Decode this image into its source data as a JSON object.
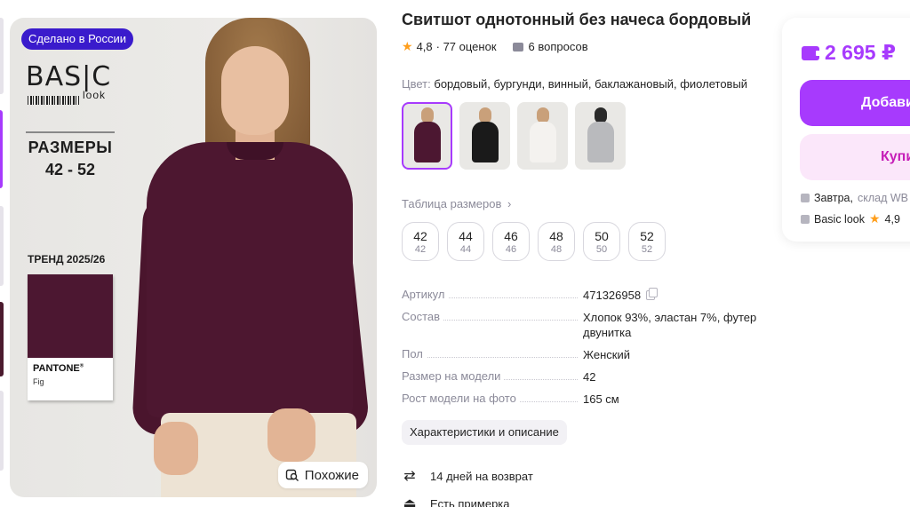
{
  "badges": {
    "made_in": "Сделано в России"
  },
  "brand_image": {
    "logo_top": "BAS|C",
    "logo_bottom": "look",
    "sizes_title": "РАЗМЕРЫ",
    "sizes_range": "42 - 52",
    "trend": "ТРЕНД 2025/26",
    "pantone_brand": "PANTONE",
    "pantone_color": "Fig"
  },
  "similar_button": "Похожие",
  "product": {
    "title": "Свитшот однотонный без начеса бордовый",
    "rating": "4,8",
    "reviews": "· 77 оценок",
    "questions": "6 вопросов",
    "color_label": "Цвет:",
    "color_value": "бордовый, бургунди, винный, баклажановый, фиолетовый"
  },
  "variants": [
    {
      "color": "#4c1731",
      "selected": true
    },
    {
      "color": "#1a1a1a",
      "selected": false
    },
    {
      "color": "#f4f2ef",
      "selected": false
    },
    {
      "color": "#b9babd",
      "selected": false
    }
  ],
  "size_table_link": "Таблица размеров",
  "sizes": [
    {
      "ru": "42",
      "int": "42"
    },
    {
      "ru": "44",
      "int": "44"
    },
    {
      "ru": "46",
      "int": "46"
    },
    {
      "ru": "48",
      "int": "48"
    },
    {
      "ru": "50",
      "int": "50"
    },
    {
      "ru": "52",
      "int": "52"
    }
  ],
  "specs": [
    {
      "key": "Артикул",
      "value": "471326958",
      "copy": true
    },
    {
      "key": "Состав",
      "value": "Хлопок 93%, эластан 7%, футер двунитка"
    },
    {
      "key": "Пол",
      "value": "Женский"
    },
    {
      "key": "Размер на модели",
      "value": "42"
    },
    {
      "key": "Рост модели на фото",
      "value": "165 см"
    }
  ],
  "chars_button": "Характеристики и описание",
  "features": [
    {
      "icon": "return-icon",
      "text": "14 дней на возврат"
    },
    {
      "icon": "hanger-icon",
      "text": "Есть примерка"
    }
  ],
  "price_panel": {
    "price": "2 695 ₽",
    "add_button": "Добавить в корзину",
    "buy_button": "Купить сейчас",
    "delivery_day": "Завтра,",
    "delivery_warehouse": "склад WB",
    "seller": "Basic look",
    "seller_rating": "4,9"
  },
  "colors": {
    "accent": "#a73afd",
    "badge_blue": "#3a1bcc",
    "star": "#ff9e1b",
    "muted": "#8b8a99",
    "buy_bg": "#fbe7fa",
    "buy_text": "#c61fb8"
  }
}
